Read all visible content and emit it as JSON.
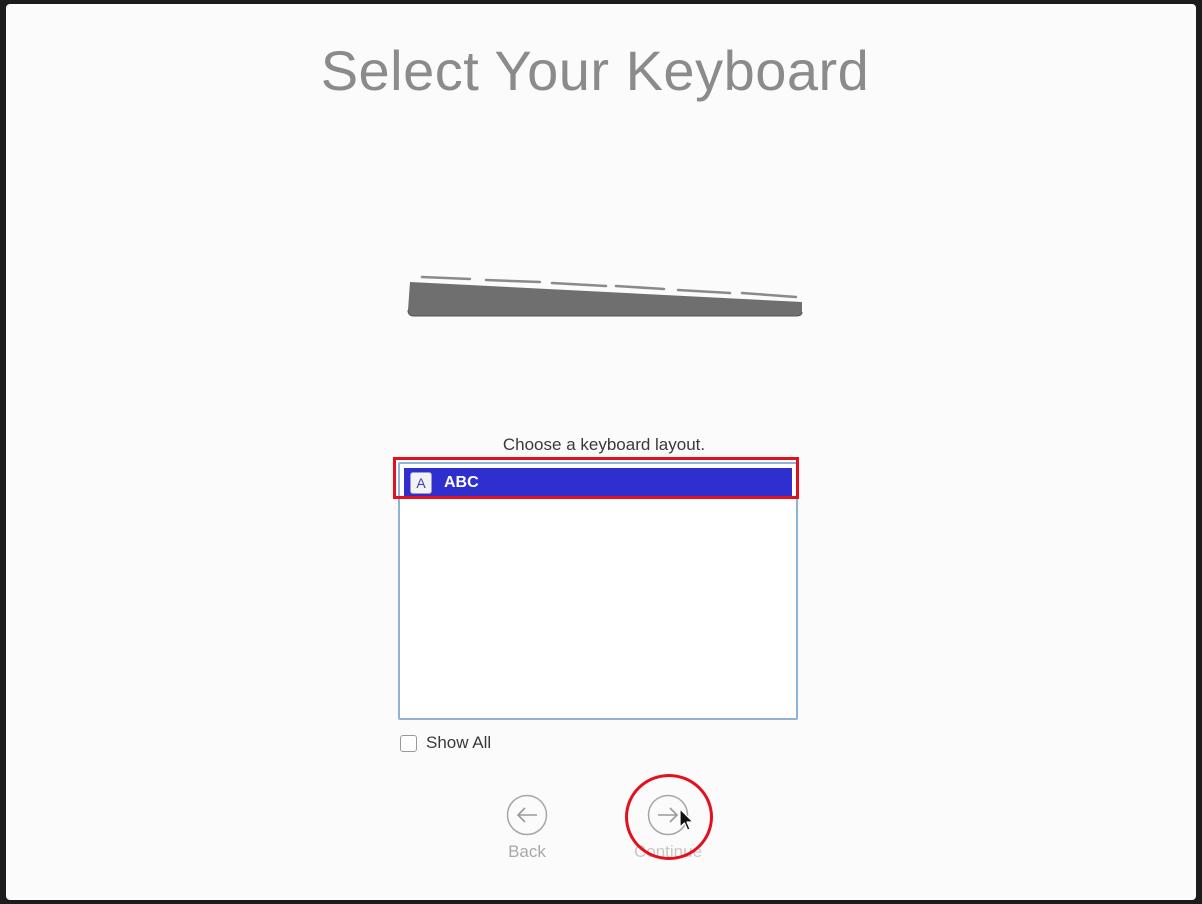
{
  "page": {
    "title": "Select Your Keyboard"
  },
  "keyboard_illustration": {
    "icon": "keyboard-icon"
  },
  "layout_picker": {
    "prompt": "Choose a keyboard layout.",
    "items": [
      {
        "icon_letter": "A",
        "label": "ABC",
        "selected": true
      }
    ],
    "show_all": {
      "label": "Show All",
      "checked": false
    }
  },
  "navigation": {
    "back": {
      "label": "Back",
      "icon": "arrow-left-icon"
    },
    "continue": {
      "label": "Continue",
      "icon": "arrow-right-icon"
    }
  },
  "annotations": {
    "highlight_color": "#e3101e",
    "selection_color": "#2f2fcf"
  }
}
